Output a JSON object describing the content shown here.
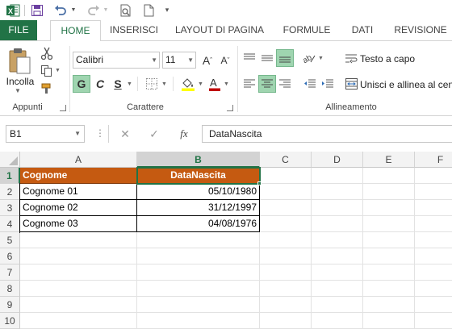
{
  "quick_access": {
    "app_icon": "excel-icon",
    "save": "save-icon",
    "undo": "undo-icon",
    "redo": "redo-icon",
    "print_preview": "print-preview-icon",
    "new": "new-document-icon"
  },
  "tabs": [
    {
      "label": "FILE"
    },
    {
      "label": "HOME"
    },
    {
      "label": "INSERISCI"
    },
    {
      "label": "LAYOUT DI PAGINA"
    },
    {
      "label": "FORMULE"
    },
    {
      "label": "DATI"
    },
    {
      "label": "REVISIONE"
    }
  ],
  "ribbon": {
    "clipboard": {
      "paste_label": "Incolla",
      "group_label": "Appunti"
    },
    "font": {
      "font_name": "Calibri",
      "font_size": "11",
      "bold": "G",
      "italic": "C",
      "underline": "S",
      "group_label": "Carattere",
      "fill_color": "#ffff00",
      "font_color": "#c00000"
    },
    "alignment": {
      "wrap_text": "Testo a capo",
      "merge_center": "Unisci e allinea al centro",
      "group_label": "Allineamento"
    }
  },
  "formula_bar": {
    "name_box": "B1",
    "fx": "fx",
    "value": "DataNascita"
  },
  "grid": {
    "columns": [
      "A",
      "B",
      "C",
      "D",
      "E",
      "F"
    ],
    "rows": [
      "1",
      "2",
      "3",
      "4",
      "5",
      "6",
      "7",
      "8",
      "9",
      "10"
    ],
    "header_fill": "#c55a11",
    "accent": "#217346",
    "data": [
      [
        "Cognome",
        "DataNascita"
      ],
      [
        "Cognome 01",
        "05/10/1980"
      ],
      [
        "Cognome 02",
        "31/12/1997"
      ],
      [
        "Cognome 03",
        "04/08/1976"
      ]
    ]
  }
}
